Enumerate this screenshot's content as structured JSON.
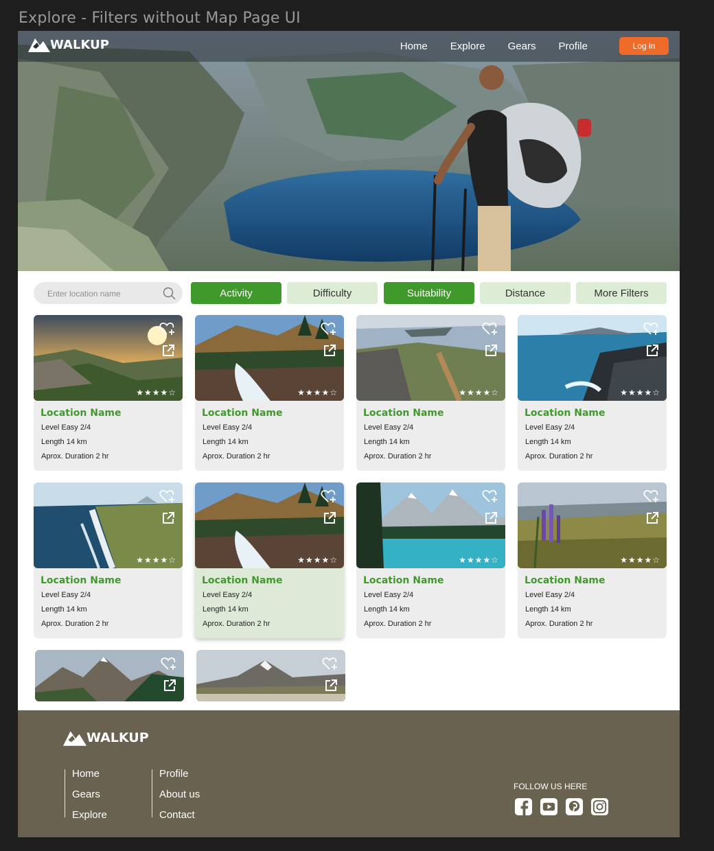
{
  "frame_title": "Explore - Filters without Map Page UI",
  "brand": "WALKUP",
  "nav": {
    "links": [
      "Home",
      "Explore",
      "Gears",
      "Profile"
    ],
    "login": "Log in"
  },
  "search": {
    "placeholder": "Enter location name"
  },
  "filters": [
    {
      "label": "Activity",
      "active": true
    },
    {
      "label": "Difficulty",
      "active": false
    },
    {
      "label": "Suitability",
      "active": true
    },
    {
      "label": "Distance",
      "active": false
    },
    {
      "label": "More Filters",
      "active": false
    }
  ],
  "cards": [
    {
      "name": "Location Name",
      "level": "Level Easy 2/4",
      "length": "Length  14 km",
      "duration": "Aprox. Duration 2 hr",
      "rating": 4
    },
    {
      "name": "Location Name",
      "level": "Level Easy 2/4",
      "length": "Length  14 km",
      "duration": "Aprox. Duration 2 hr",
      "rating": 4
    },
    {
      "name": "Location Name",
      "level": "Level Easy 2/4",
      "length": "Length  14 km",
      "duration": "Aprox. Duration 2 hr",
      "rating": 4
    },
    {
      "name": "Location Name",
      "level": "Level Easy 2/4",
      "length": "Length  14 km",
      "duration": "Aprox. Duration 2 hr",
      "rating": 4
    },
    {
      "name": "Location Name",
      "level": "Level Easy 2/4",
      "length": "Length  14 km",
      "duration": "Aprox. Duration 2 hr",
      "rating": 4
    },
    {
      "name": "Location Name",
      "level": "Level Easy 2/4",
      "length": "Length  14 km",
      "duration": "Aprox. Duration 2 hr",
      "rating": 4
    },
    {
      "name": "Location Name",
      "level": "Level Easy 2/4",
      "length": "Length  14 km",
      "duration": "Aprox. Duration 2 hr",
      "rating": 4
    },
    {
      "name": "Location Name",
      "level": "Level Easy 2/4",
      "length": "Length  14 km",
      "duration": "Aprox. Duration 2 hr",
      "rating": 4
    }
  ],
  "footer": {
    "col1": [
      "Home",
      "Gears",
      "Explore"
    ],
    "col2": [
      "Profile",
      "About us",
      "Contact"
    ],
    "follow": "FOLLOW US HERE",
    "socials": [
      "facebook-icon",
      "youtube-icon",
      "pinterest-icon",
      "instagram-icon"
    ]
  },
  "colors": {
    "accent_green": "#3f9a2b",
    "light_green": "#ddecd5",
    "login_orange": "#ef6b2a",
    "footer_bg": "#6a6251"
  }
}
